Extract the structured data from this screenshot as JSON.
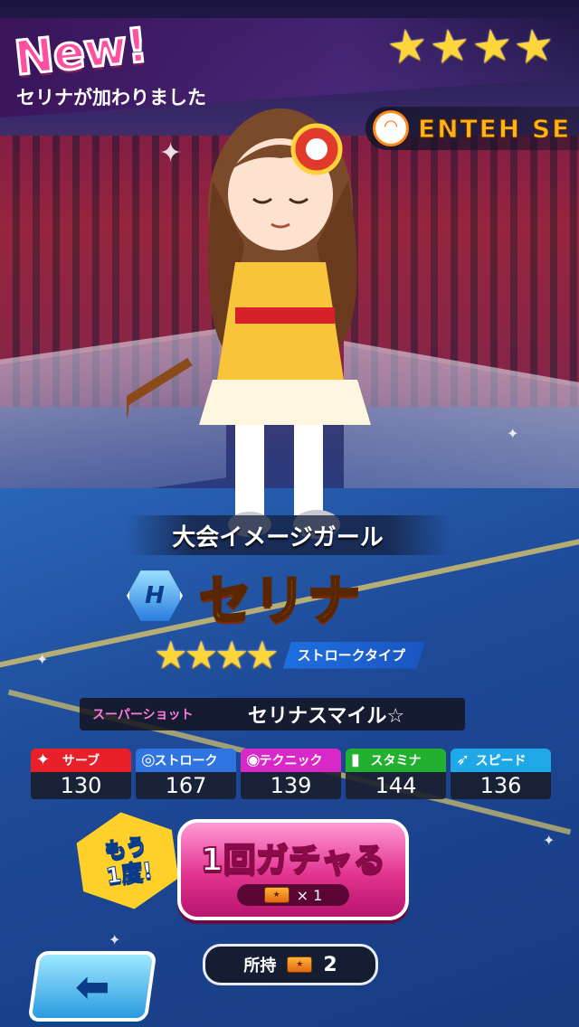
{
  "banner": {
    "badge": "New!",
    "message": "セリナが加わりました",
    "stars": 4
  },
  "event_logo": {
    "text": "ENTEH SE"
  },
  "card": {
    "subtitle": "大会イメージガール",
    "rarity": "H",
    "name": "セリナ",
    "stars": 4,
    "type": "ストロークタイプ"
  },
  "skill": {
    "label": "スーパーショット",
    "name": "セリナスマイル☆"
  },
  "stats": [
    {
      "label": "サーブ",
      "value": "130",
      "color": "#e8202a",
      "icon": "serve-icon"
    },
    {
      "label": "ストローク",
      "value": "167",
      "color": "#2f74e0",
      "icon": "racket-icon"
    },
    {
      "label": "テクニック",
      "value": "139",
      "color": "#d828c8",
      "icon": "technique-icon"
    },
    {
      "label": "スタミナ",
      "value": "144",
      "color": "#22b030",
      "icon": "bottle-icon"
    },
    {
      "label": "スピード",
      "value": "136",
      "color": "#1fa8e8",
      "icon": "shoe-icon"
    }
  ],
  "again": {
    "line1": "もう",
    "line2": "1度!"
  },
  "gacha_button": {
    "label": "1回ガチャる",
    "cost": "× 1"
  },
  "owned": {
    "label": "所持",
    "count": "2"
  },
  "back_button": {
    "icon": "back-arrow-icon"
  }
}
